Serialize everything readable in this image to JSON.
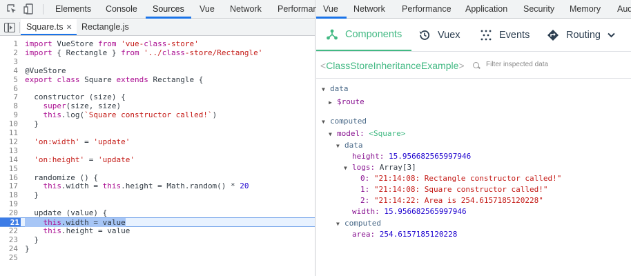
{
  "left_tabs": {
    "items": [
      "Elements",
      "Console",
      "Sources",
      "Vue",
      "Network",
      "Performan"
    ]
  },
  "file_tabs": {
    "active": "Square.ts",
    "other": "Rectangle.js",
    "close_glyph": "✕"
  },
  "code": {
    "lines": [
      {
        "n": "1",
        "t": "import VueStore from 'vue-class-store'"
      },
      {
        "n": "2",
        "t": "import { Rectangle } from '../class-store/Rectangle'"
      },
      {
        "n": "3",
        "t": ""
      },
      {
        "n": "4",
        "t": "@VueStore"
      },
      {
        "n": "5",
        "t": "export class Square extends Rectangle {"
      },
      {
        "n": "6",
        "t": ""
      },
      {
        "n": "7",
        "t": "  constructor (size) {"
      },
      {
        "n": "8",
        "t": "    super(size, size)"
      },
      {
        "n": "9",
        "t": "    this.log(`Square constructor called!`)"
      },
      {
        "n": "10",
        "t": "  }"
      },
      {
        "n": "11",
        "t": ""
      },
      {
        "n": "12",
        "t": "  'on:width' = 'update'"
      },
      {
        "n": "13",
        "t": ""
      },
      {
        "n": "14",
        "t": "  'on:height' = 'update'"
      },
      {
        "n": "15",
        "t": ""
      },
      {
        "n": "16",
        "t": "  randomize () {"
      },
      {
        "n": "17",
        "t": "    this.width = this.height = Math.random() * 20"
      },
      {
        "n": "18",
        "t": "  }"
      },
      {
        "n": "19",
        "t": ""
      },
      {
        "n": "20",
        "t": "  update (value) {"
      },
      {
        "n": "21",
        "t": "    this.width = value"
      },
      {
        "n": "22",
        "t": "    this.height = value"
      },
      {
        "n": "23",
        "t": "  }"
      },
      {
        "n": "24",
        "t": "}"
      },
      {
        "n": "25",
        "t": ""
      }
    ]
  },
  "right_tabs": {
    "items": [
      "Vue",
      "Network",
      "Performance",
      "Application",
      "Security",
      "Memory",
      "Aud"
    ]
  },
  "vue_tabs": {
    "components": "Components",
    "vuex": "Vuex",
    "events": "Events",
    "routing": "Routing"
  },
  "breadcrumb": {
    "open": "<",
    "component": "ClassStoreInheritanceExample",
    "close": ">",
    "filter_placeholder": "Filter inspected data"
  },
  "inspector": {
    "data_label": "data",
    "route_key": "$route",
    "computed_label": "computed",
    "model_key": "model:",
    "model_type": "<Square>",
    "model_data_label": "data",
    "height_key": "height:",
    "height_val": "15.956682565997946",
    "logs_key": "logs:",
    "logs_type": "Array[3]",
    "logs": [
      {
        "idx": "0:",
        "val": "\"21:14:08: Rectangle constructor called!\""
      },
      {
        "idx": "1:",
        "val": "\"21:14:08: Square constructor called!\""
      },
      {
        "idx": "2:",
        "val": "\"21:14:22: Area is 254.6157185120228\""
      }
    ],
    "width_key": "width:",
    "width_val": "15.956682565997946",
    "model_computed_label": "computed",
    "area_key": "area:",
    "area_val": "254.6157185120228"
  },
  "colors": {
    "vue_green": "#42b983",
    "devtools_blue": "#1a73e8",
    "exec_line_highlight": "#3d7ce6"
  },
  "icons": [
    "inspect-element-icon",
    "device-toolbar-icon",
    "navigator-toggle-icon",
    "components-icon",
    "vuex-history-icon",
    "events-icon",
    "routing-icon",
    "chevron-down-icon",
    "search-icon"
  ]
}
